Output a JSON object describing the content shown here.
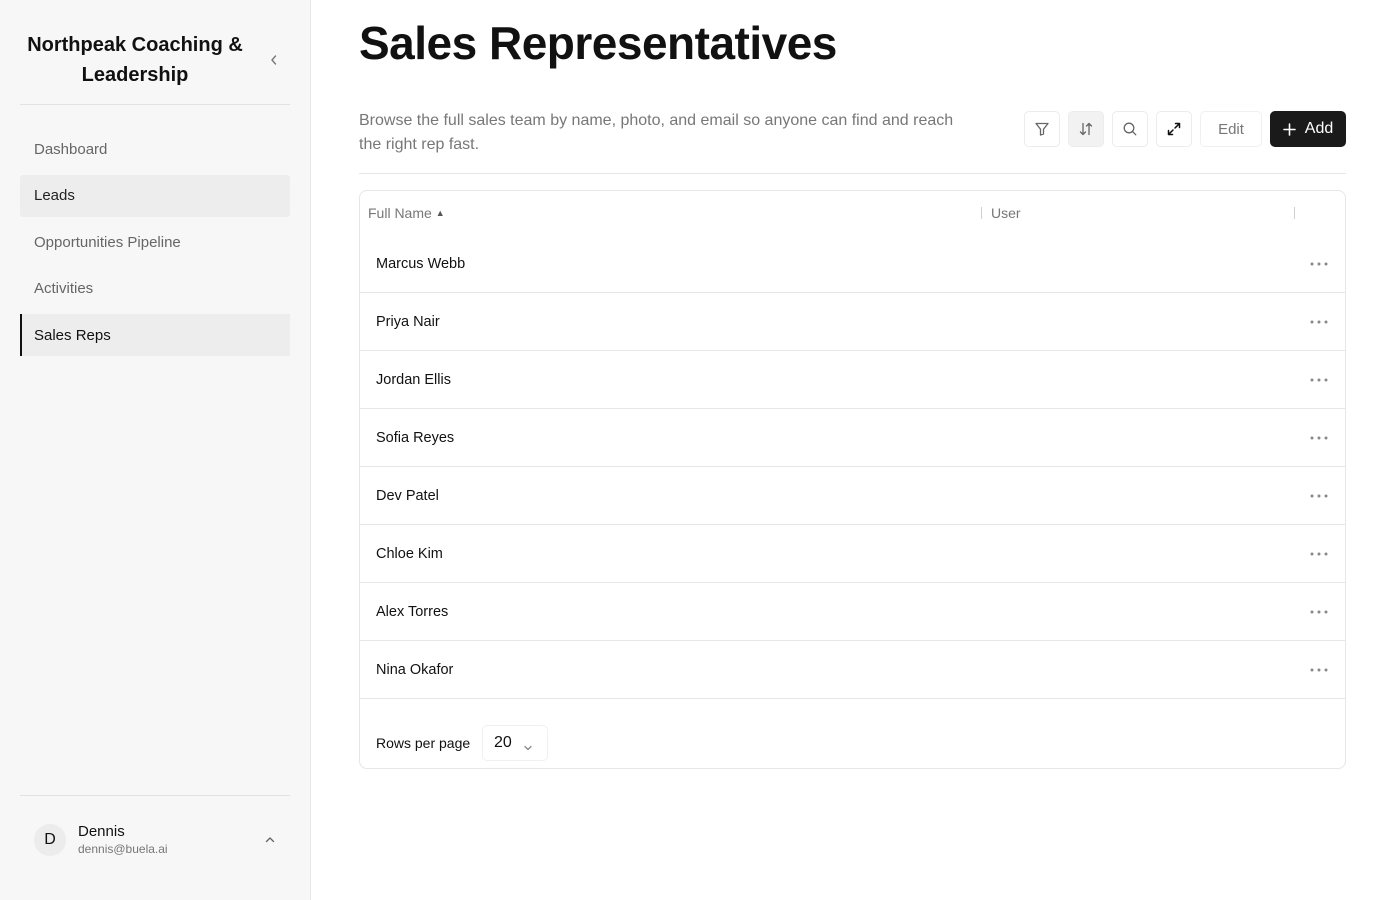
{
  "sidebar": {
    "brand": "Northpeak Coaching & Leadership",
    "nav": [
      {
        "label": "Dashboard",
        "state": "default"
      },
      {
        "label": "Leads",
        "state": "hover"
      },
      {
        "label": "Opportunities Pipeline",
        "state": "default"
      },
      {
        "label": "Activities",
        "state": "default"
      },
      {
        "label": "Sales Reps",
        "state": "active"
      }
    ],
    "user": {
      "initial": "D",
      "name": "Dennis",
      "email": "dennis@buela.ai"
    }
  },
  "page": {
    "title": "Sales Representatives",
    "description": "Browse the full sales team by name, photo, and email so anyone can find and reach the right rep fast."
  },
  "toolbar": {
    "icons": [
      "filter-icon",
      "sort-icon",
      "search-icon",
      "expand-icon"
    ],
    "edit_label": "Edit",
    "add_label": "Add"
  },
  "table": {
    "columns": [
      "Full Name",
      "User"
    ],
    "sort": {
      "column": "Full Name",
      "direction": "ascending"
    },
    "rows": [
      {
        "full_name": "Marcus Webb",
        "user": ""
      },
      {
        "full_name": "Priya Nair",
        "user": ""
      },
      {
        "full_name": "Jordan Ellis",
        "user": ""
      },
      {
        "full_name": "Sofia Reyes",
        "user": ""
      },
      {
        "full_name": "Dev Patel",
        "user": ""
      },
      {
        "full_name": "Chloe Kim",
        "user": ""
      },
      {
        "full_name": "Alex Torres",
        "user": ""
      },
      {
        "full_name": "Nina Okafor",
        "user": ""
      }
    ],
    "rows_per_page_label": "Rows per page",
    "rows_per_page_value": "20"
  }
}
